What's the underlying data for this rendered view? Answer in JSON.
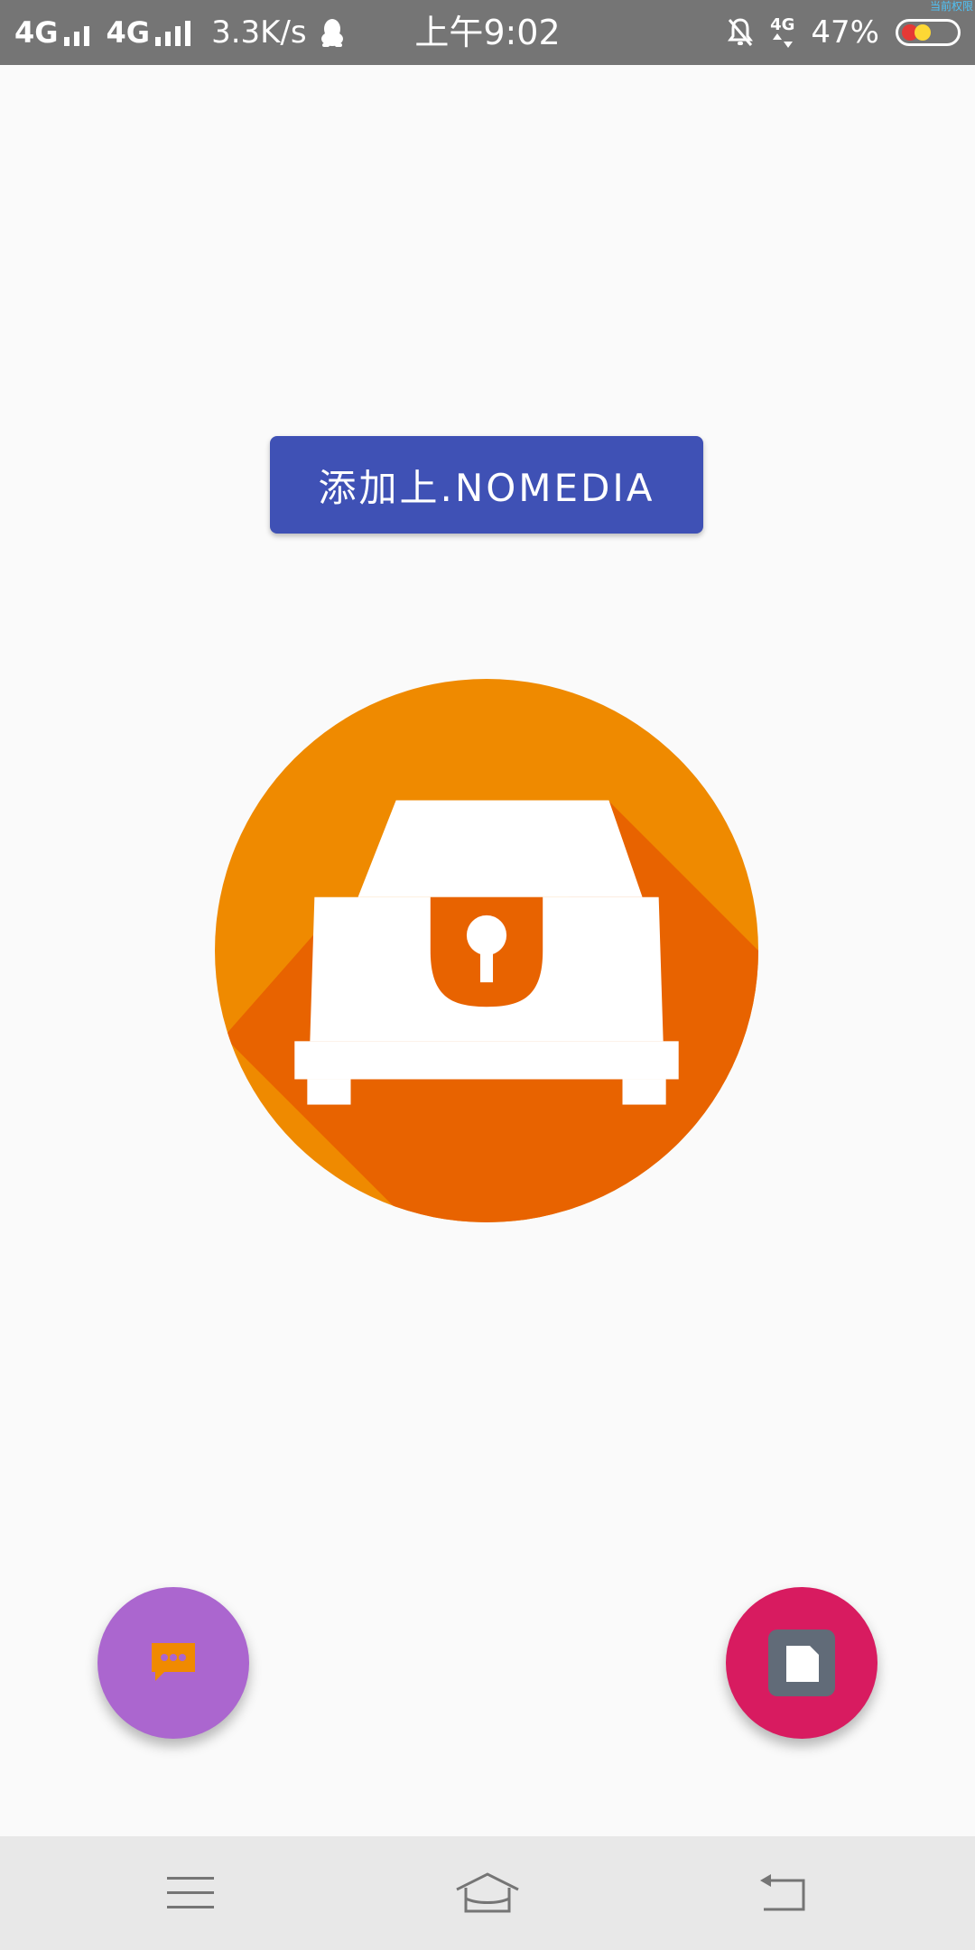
{
  "status_bar": {
    "sim1_network": "4G",
    "sim2_network": "4G",
    "net_speed": "3.3K/s",
    "time": "上午9:02",
    "data_badge": "4G",
    "battery_percent": "47%",
    "corner_mark": "当前权限",
    "icons": [
      "signal-icon",
      "signal-icon",
      "qq-penguin-icon",
      "mute-bell-icon",
      "data-arrows-icon",
      "battery-icon"
    ]
  },
  "main": {
    "add_nomedia_button": "添加上.NOMEDIA",
    "logo_icon": "treasure-chest-lock-icon"
  },
  "fabs": {
    "left_icon": "chat-bubble-icon",
    "right_icon": "sd-card-icon"
  },
  "nav_bar": {
    "icons": [
      "menu-icon",
      "home-icon",
      "back-icon"
    ]
  },
  "colors": {
    "status_bar_bg": "#757575",
    "page_bg": "#fafafa",
    "primary_button": "#3f51b5",
    "logo_circle": "#ef8a00",
    "logo_shadow": "#e86300",
    "fab_left": "#ab66cf",
    "fab_left_icon": "#f08a00",
    "fab_right": "#d81b60",
    "fab_right_icon_bg": "#616b78",
    "nav_bar_bg": "#e8e8e8"
  }
}
